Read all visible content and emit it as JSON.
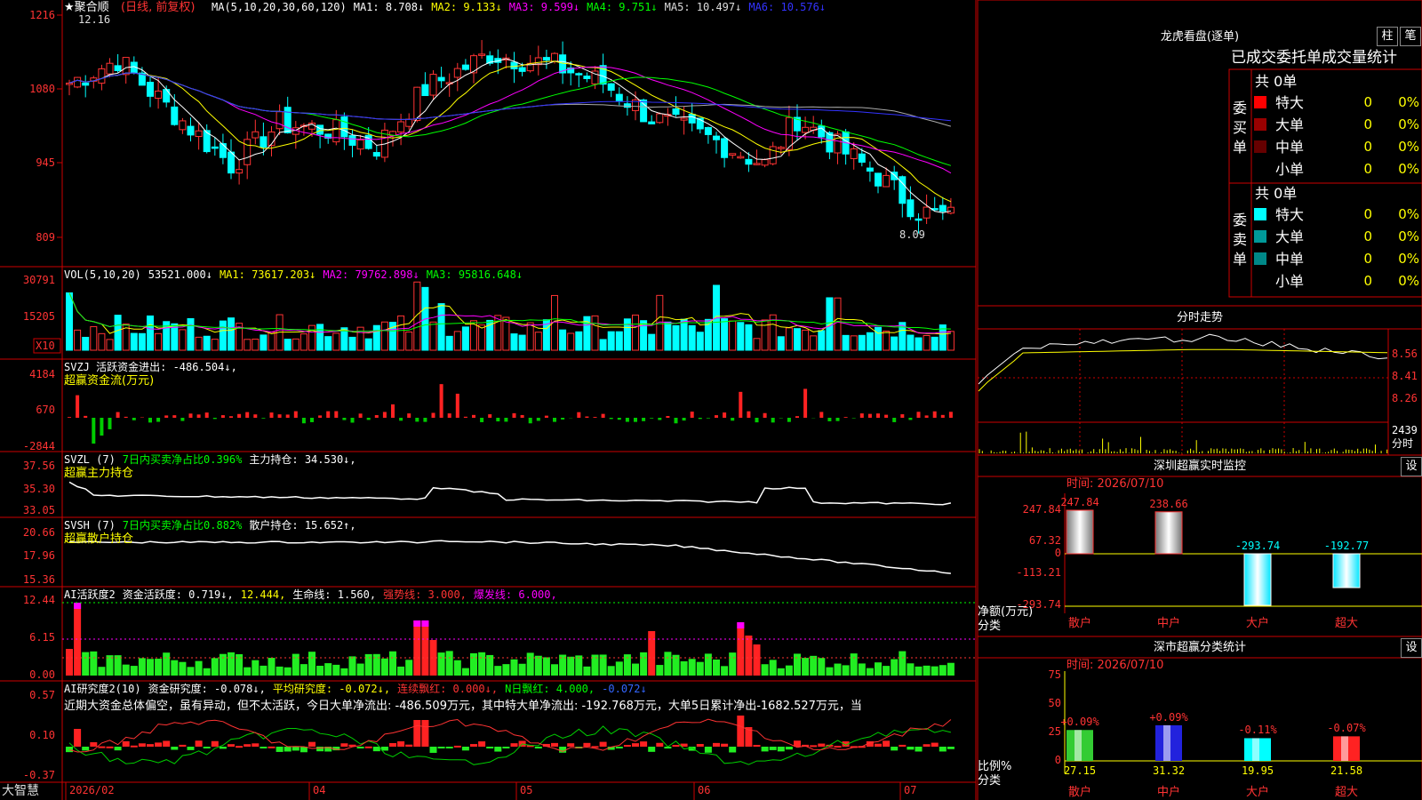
{
  "stock": {
    "name": "★聚合顺",
    "period": "(日线, 前复权)",
    "high_label": "12.16",
    "low_label": "8.09"
  },
  "ma": {
    "header": "MA(5,10,20,30,60,120)",
    "items": [
      {
        "text": "MA1: 8.708↓",
        "color": "#ffffff"
      },
      {
        "text": "MA2: 9.133↓",
        "color": "#ffff00"
      },
      {
        "text": "MA3: 9.599↓",
        "color": "#ff00ff"
      },
      {
        "text": "MA4: 9.751↓",
        "color": "#00ff00"
      },
      {
        "text": "MA5: 10.497↓",
        "color": "#dddddd"
      },
      {
        "text": "MA6: 10.576↓",
        "color": "#3333ff"
      }
    ],
    "axis": [
      "1216",
      "1080",
      "945",
      "809"
    ]
  },
  "vol": {
    "header": "VOL(5,10,20)",
    "items": [
      {
        "text": "53521.000↓",
        "color": "#ffffff"
      },
      {
        "text": "MA1: 73617.203↓",
        "color": "#ffff00"
      },
      {
        "text": "MA2: 79762.898↓",
        "color": "#ff00ff"
      },
      {
        "text": "MA3: 95816.648↓",
        "color": "#00ff00"
      }
    ],
    "axis": [
      "30791",
      "15205"
    ],
    "unit": "X10"
  },
  "svzj": {
    "line1": [
      {
        "text": "SVZJ  活跃资金进出: -486.504↓,",
        "color": "#ffffff"
      }
    ],
    "line2": "超赢资金流(万元)",
    "axis": [
      "4184",
      "670",
      "-2844"
    ]
  },
  "svzl": {
    "line1": [
      {
        "text": "SVZL (7)",
        "color": "#ffffff"
      },
      {
        "text": "7日内买卖净占比0.396%",
        "color": "#00ff00"
      },
      {
        "text": "主力持仓: 34.530↓,",
        "color": "#ffffff"
      }
    ],
    "line2": "超赢主力持仓",
    "axis": [
      "37.56",
      "35.30",
      "33.05"
    ]
  },
  "svsh": {
    "line1": [
      {
        "text": "SVSH (7)",
        "color": "#ffffff"
      },
      {
        "text": "7日内买卖净占比0.882%",
        "color": "#00ff00"
      },
      {
        "text": "散户持仓: 15.652↑,",
        "color": "#ffffff"
      }
    ],
    "line2": "超赢散户持仓",
    "axis": [
      "20.66",
      "17.96",
      "15.36"
    ]
  },
  "ai1": {
    "line1": [
      {
        "text": "AI活跃度2",
        "color": "#ffffff"
      },
      {
        "text": "资金活跃度: 0.719↓,",
        "color": "#ffffff"
      },
      {
        "text": "12.444,",
        "color": "#ffff00"
      },
      {
        "text": "生命线: 1.560,",
        "color": "#ffffff"
      },
      {
        "text": "强势线: 3.000,",
        "color": "#ff3333"
      },
      {
        "text": "爆发线: 6.000,",
        "color": "#ff00ff"
      }
    ],
    "axis": [
      "12.44",
      "6.15",
      "0.00"
    ]
  },
  "ai2": {
    "line1": [
      {
        "text": "AI研究度2(10)",
        "color": "#ffffff"
      },
      {
        "text": "资金研究度: -0.078↓,",
        "color": "#ffffff"
      },
      {
        "text": "平均研究度: -0.072↓,",
        "color": "#ffff00"
      },
      {
        "text": "连续飘红: 0.000↓,",
        "color": "#ff3333"
      },
      {
        "text": "N日飘红: 4.000,",
        "color": "#00ff00"
      },
      {
        "text": "-0.072↓",
        "color": "#3366ff"
      }
    ],
    "line2": "近期大资金总体偏空，虽有异动，但不太活跃，今日大单净流出: -486.509万元，其中特大单净流出: -192.768万元，大单5日累计净出-1682.527万元，当",
    "axis": [
      "0.57",
      "0.10",
      "-0.37"
    ]
  },
  "xaxis": {
    "labels": [
      "2026/02",
      "04",
      "05",
      "06",
      "07"
    ],
    "brand": "大智慧"
  },
  "dragon": {
    "title": "龙虎看盘(逐单)",
    "btn1": "柱",
    "btn2": "笔",
    "subtitle": "已成交委托单成交量统计",
    "buy_label": "委买单",
    "sell_label": "委卖单",
    "buy_total": "共 0单",
    "sell_total": "共 0单",
    "buy_rows": [
      {
        "name": "特大",
        "count": "0",
        "pct": "0%",
        "color": "#ff0000"
      },
      {
        "name": "大单",
        "count": "0",
        "pct": "0%",
        "color": "#990000"
      },
      {
        "name": "中单",
        "count": "0",
        "pct": "0%",
        "color": "#660000"
      },
      {
        "name": "小单",
        "count": "0",
        "pct": "0%",
        "color": ""
      }
    ],
    "sell_rows": [
      {
        "name": "特大",
        "count": "0",
        "pct": "0%",
        "color": "#00ffff"
      },
      {
        "name": "大单",
        "count": "0",
        "pct": "0%",
        "color": "#009999"
      },
      {
        "name": "中单",
        "count": "0",
        "pct": "0%",
        "color": "#008888"
      },
      {
        "name": "小单",
        "count": "0",
        "pct": "0%",
        "color": ""
      }
    ]
  },
  "fenshi": {
    "title": "分时走势",
    "axis": [
      "8.56",
      "8.41",
      "8.26"
    ],
    "vol_value": "2439",
    "vol_label": "分时"
  },
  "sz_monitor": {
    "title": "深圳超赢实时监控",
    "set_label": "设",
    "time": "时间: 2026/07/10",
    "axis": [
      "247.84",
      "67.32",
      "0",
      "-113.21",
      "-293.74"
    ],
    "ylabel1": "净额(万元)",
    "ylabel2": "分类",
    "categories": [
      "散户",
      "中户",
      "大户",
      "超大"
    ],
    "values": [
      247.84,
      238.66,
      -293.74,
      -192.77
    ],
    "value_labels": [
      "247.84",
      "238.66",
      "-293.74",
      "-192.77"
    ]
  },
  "sh_stats": {
    "title": "深市超赢分类统计",
    "set_label": "设",
    "time": "时间: 2026/07/10",
    "axis": [
      "75",
      "50",
      "25",
      "0"
    ],
    "ylabel1": "比例%",
    "ylabel2": "分类",
    "categories": [
      "散户",
      "中户",
      "大户",
      "超大"
    ],
    "values": [
      27.15,
      31.32,
      19.95,
      21.58
    ],
    "value_labels": [
      "27.15",
      "31.32",
      "19.95",
      "21.58"
    ],
    "change_labels": [
      "+0.09%",
      "+0.09%",
      "-0.11%",
      "-0.07%"
    ],
    "bar_colors": [
      "#33cc33",
      "#2222dd",
      "#00ffff",
      "#ff2222"
    ]
  },
  "chart_data": [
    {
      "type": "bar",
      "title": "深圳超赢实时监控",
      "categories": [
        "散户",
        "中户",
        "大户",
        "超大"
      ],
      "values": [
        247.84,
        238.66,
        -293.74,
        -192.77
      ],
      "ylabel": "净额(万元)",
      "xlabel": "分类",
      "ylim": [
        -293.74,
        247.84
      ]
    },
    {
      "type": "bar",
      "title": "深市超赢分类统计",
      "categories": [
        "散户",
        "中户",
        "大户",
        "超大"
      ],
      "values": [
        27.15,
        31.32,
        19.95,
        21.58
      ],
      "ylabel": "比例%",
      "xlabel": "分类",
      "ylim": [
        0,
        75
      ]
    }
  ]
}
